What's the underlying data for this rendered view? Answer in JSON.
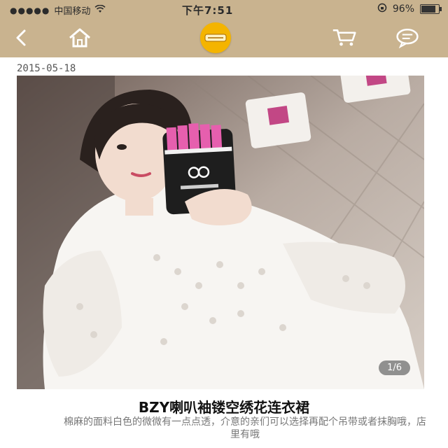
{
  "status_bar": {
    "signal": "●●●●●",
    "carrier": "中国移动",
    "time": "下午7:51",
    "battery": "96%"
  },
  "nav": {
    "icons": [
      "back-icon",
      "home-icon",
      "logo-icon",
      "cart-icon",
      "chat-icon"
    ]
  },
  "post": {
    "date": "2015-05-18",
    "image_counter": "1/6",
    "title": "BZY喇叭袖镂空绣花连衣裙",
    "description": "棉麻的面料白色的微微有一点点透，介意的亲们可以选择再配个吊带或者抹胸哦，店里有哦"
  },
  "colors": {
    "bar": "#c9b38f",
    "logo": "#f4b400"
  }
}
